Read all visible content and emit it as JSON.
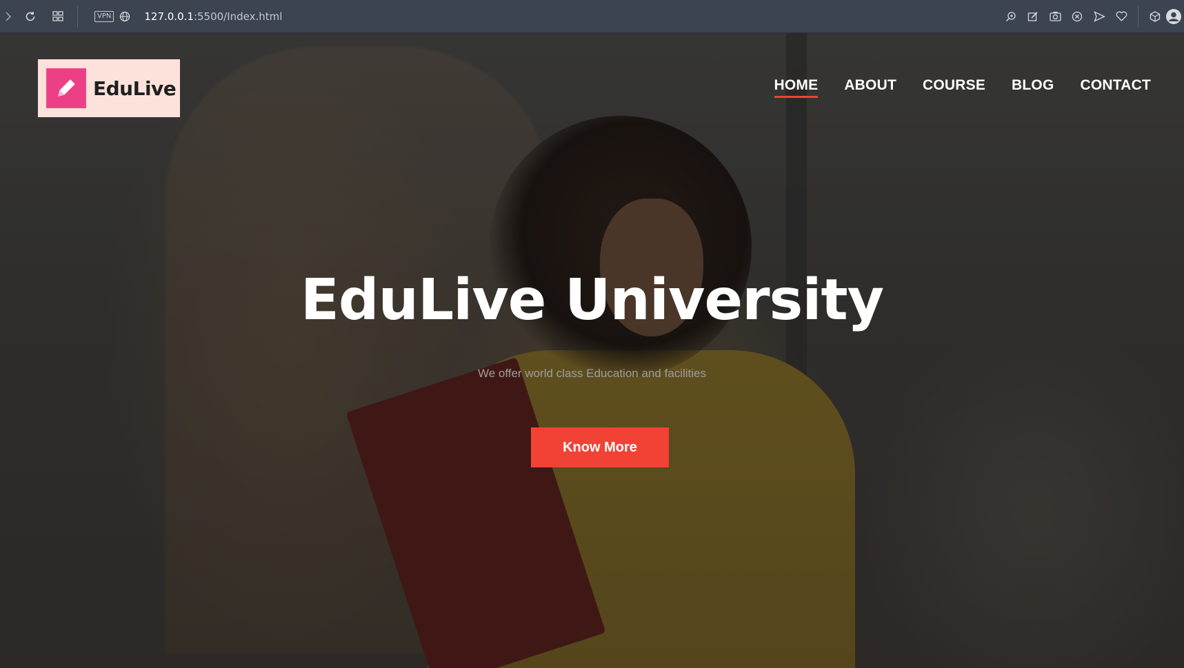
{
  "browser": {
    "url_host": "127.0.0.1",
    "url_rest": ":5500/Index.html",
    "vpn_label": "VPN",
    "icons": [
      "back-icon",
      "reload-icon",
      "tabs-grid-icon",
      "globe-icon",
      "zoom-icon",
      "edit-icon",
      "camera-icon",
      "shield-icon",
      "send-icon",
      "heart-icon",
      "cube-icon",
      "profile-icon"
    ]
  },
  "header": {
    "logo_text": "EduLive",
    "nav": [
      {
        "label": "HOME",
        "active": true
      },
      {
        "label": "ABOUT",
        "active": false
      },
      {
        "label": "COURSE",
        "active": false
      },
      {
        "label": "BLOG",
        "active": false
      },
      {
        "label": "CONTACT",
        "active": false
      }
    ]
  },
  "hero": {
    "title": "EduLive University",
    "subtitle": "We offer world class Education and facilities",
    "cta_label": "Know More"
  },
  "colors": {
    "accent": "#f24236",
    "logo_bg": "#fde2dc",
    "logo_icon": "#ec3f86",
    "browser_bar": "#3b4450"
  }
}
